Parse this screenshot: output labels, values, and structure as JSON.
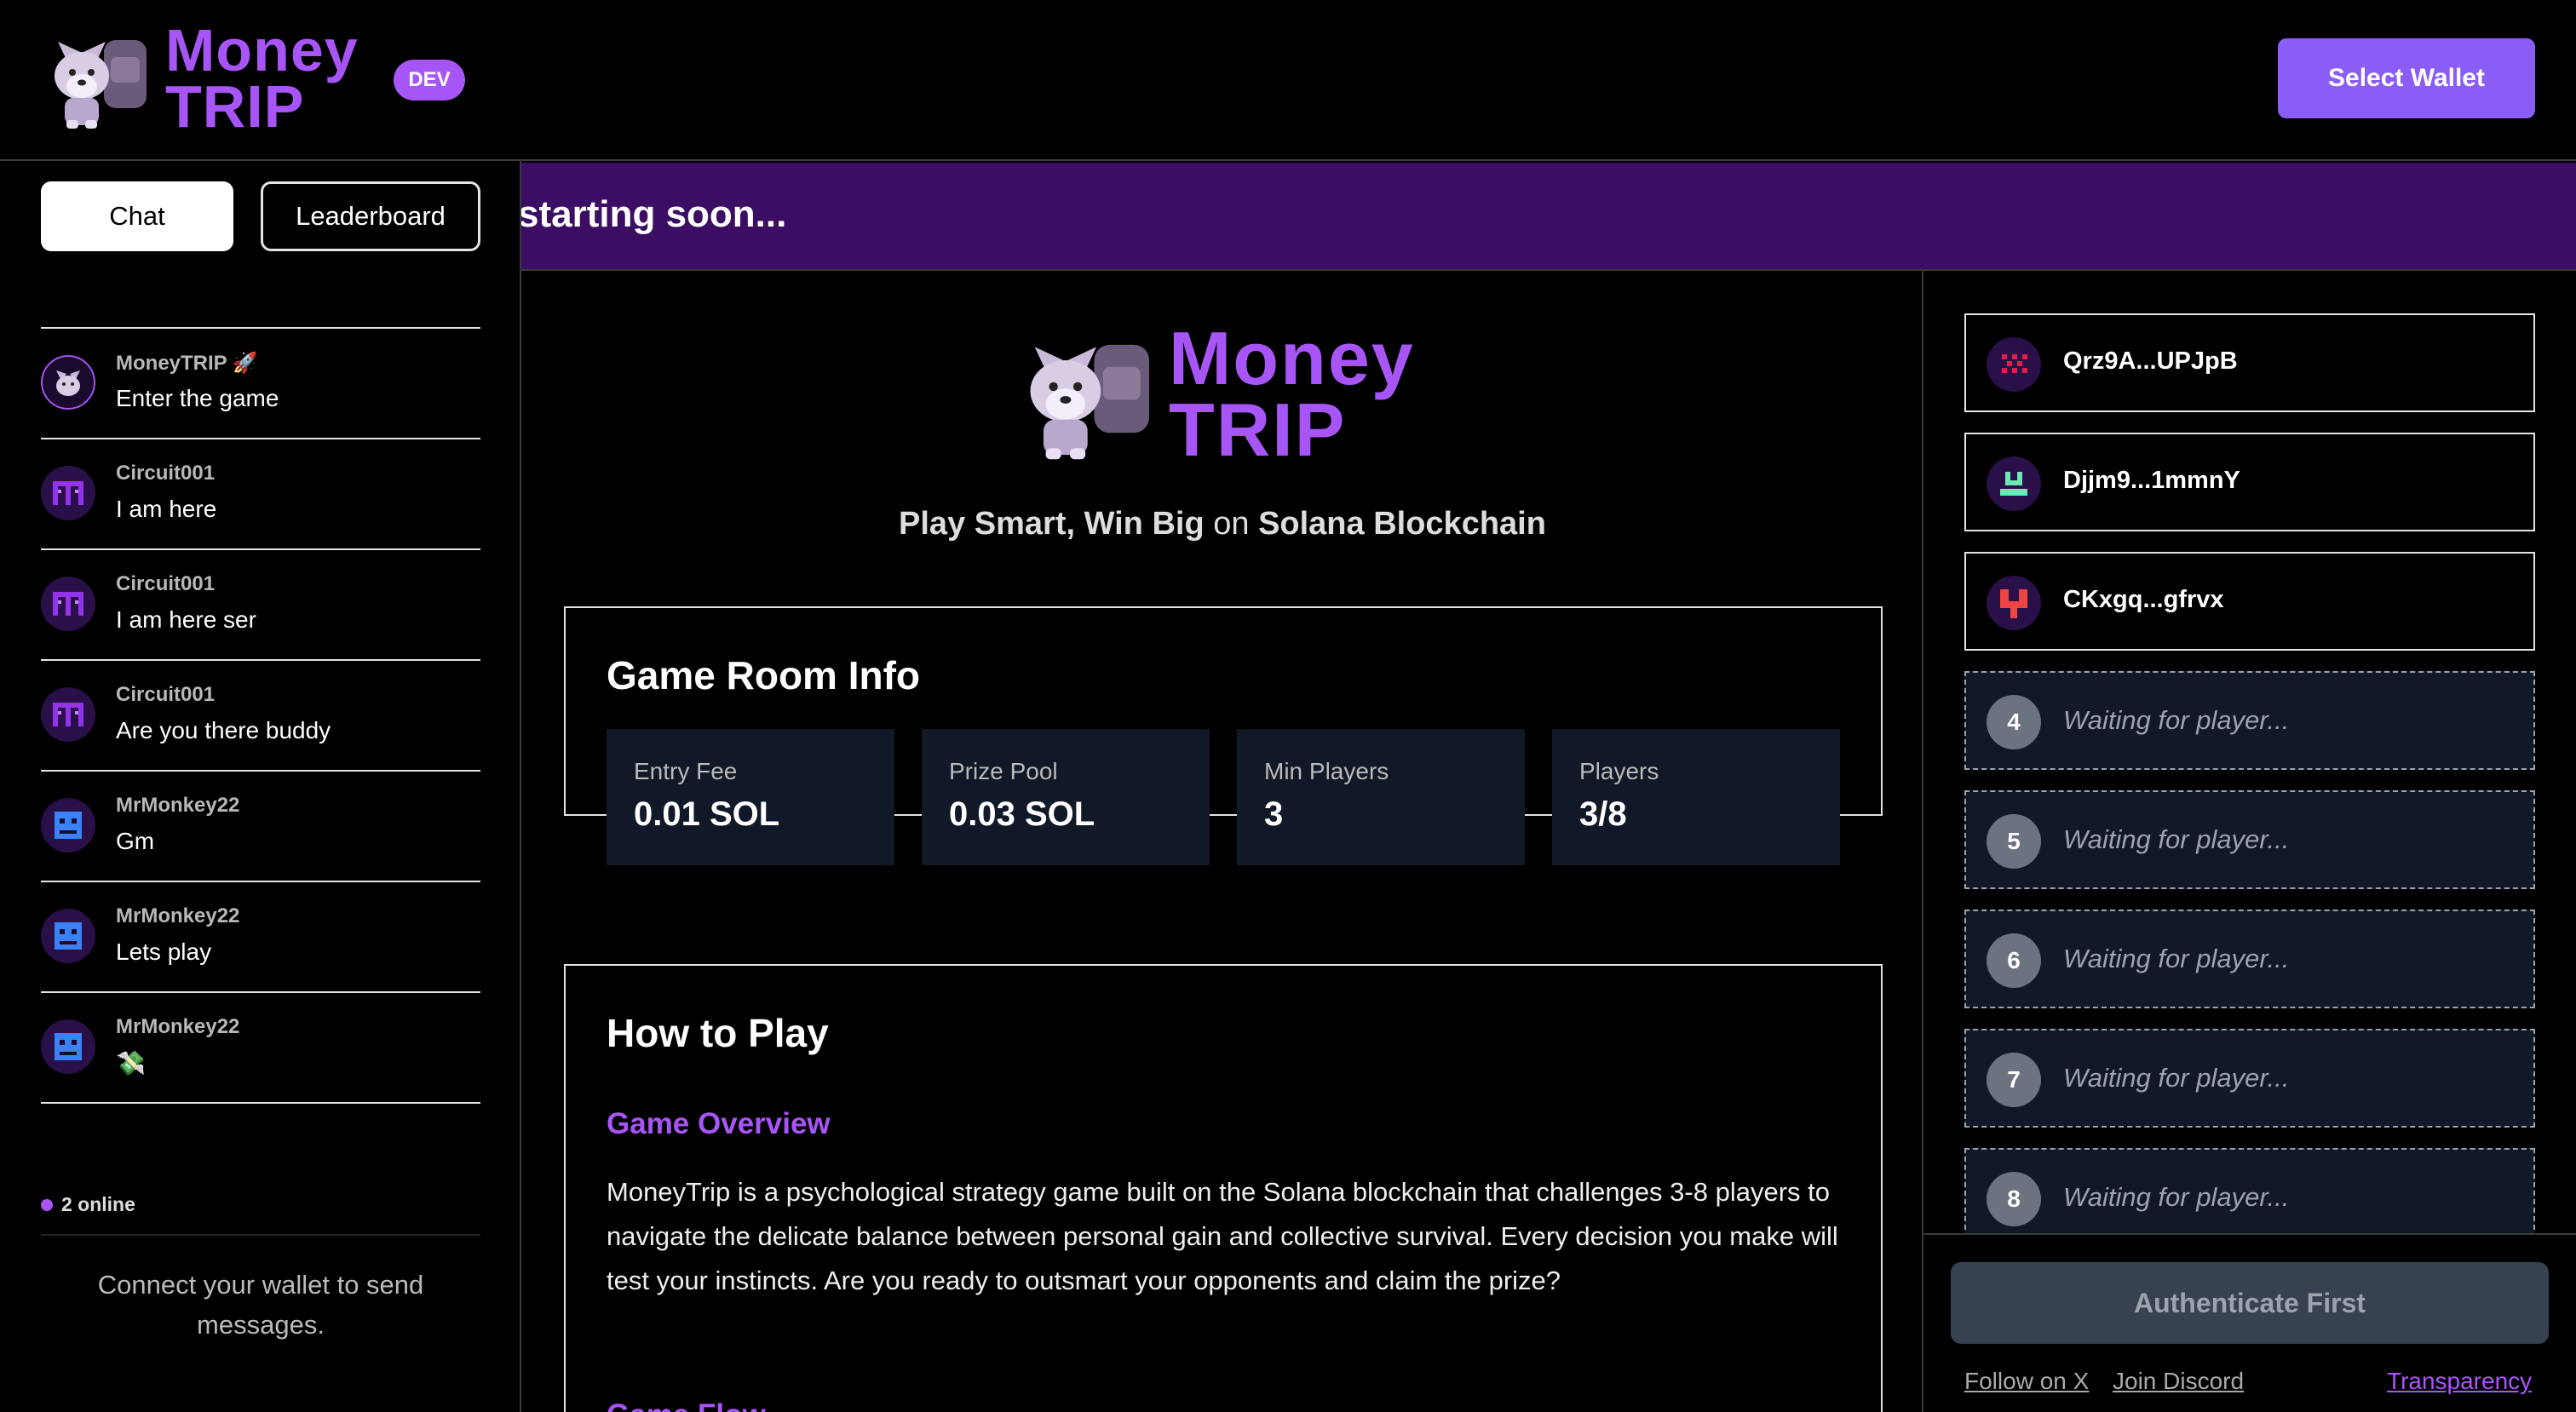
{
  "header": {
    "brand_line1": "Money",
    "brand_line2": "TRIP",
    "dev_badge": "DEV",
    "select_wallet": "Select Wallet"
  },
  "sidebar": {
    "tabs": [
      "Chat",
      "Leaderboard"
    ],
    "messages": [
      {
        "user": "MoneyTRIP 🚀",
        "text": "Enter the game"
      },
      {
        "user": "Circuit001",
        "text": "I am here"
      },
      {
        "user": "Circuit001",
        "text": "I am here ser"
      },
      {
        "user": "Circuit001",
        "text": "Are you there buddy"
      },
      {
        "user": "MrMonkey22",
        "text": "Gm"
      },
      {
        "user": "MrMonkey22",
        "text": "Lets play"
      },
      {
        "user": "MrMonkey22",
        "text": "💸"
      }
    ],
    "online": "2 online",
    "connect_note": "Connect your wallet to send messages."
  },
  "banner": {
    "text": "starting soon..."
  },
  "main": {
    "logo_line1": "Money",
    "logo_line2": "TRIP",
    "tagline_a": "Play Smart, Win Big",
    "tagline_b": "on",
    "tagline_c": "Solana Blockchain",
    "info_title": "Game Room Info",
    "stats": [
      {
        "label": "Entry Fee",
        "value": "0.01 SOL"
      },
      {
        "label": "Prize Pool",
        "value": "0.03 SOL"
      },
      {
        "label": "Min Players",
        "value": "3"
      },
      {
        "label": "Players",
        "value": "3/8"
      }
    ],
    "howto_title": "How to Play",
    "overview_title": "Game Overview",
    "overview_text": "MoneyTrip is a psychological strategy game built on the Solana blockchain that challenges 3-8 players to navigate the delicate balance between personal gain and collective survival. Every decision you make will test your instincts. Are you ready to outsmart your opponents and claim the prize?",
    "flow_title": "Game Flow"
  },
  "players": {
    "filled": [
      {
        "name": "Qrz9A...UPJpB",
        "color": "#e11d48"
      },
      {
        "name": "Djjm9...1mmnY",
        "color": "#6ee7b7"
      },
      {
        "name": "CKxgq...gfrvx",
        "color": "#ef4444"
      }
    ],
    "waiting": [
      {
        "num": "4",
        "text": "Waiting for player..."
      },
      {
        "num": "5",
        "text": "Waiting for player..."
      },
      {
        "num": "6",
        "text": "Waiting for player..."
      },
      {
        "num": "7",
        "text": "Waiting for player..."
      },
      {
        "num": "8",
        "text": "Waiting for player..."
      }
    ]
  },
  "footer": {
    "auth_button": "Authenticate First",
    "follow_x": "Follow on X",
    "join_discord": "Join Discord",
    "transparency": "Transparency"
  },
  "colors": {
    "accent": "#a855f7",
    "button": "#8b5cf6",
    "banner": "#3b0d63",
    "stat_bg": "#111827"
  }
}
